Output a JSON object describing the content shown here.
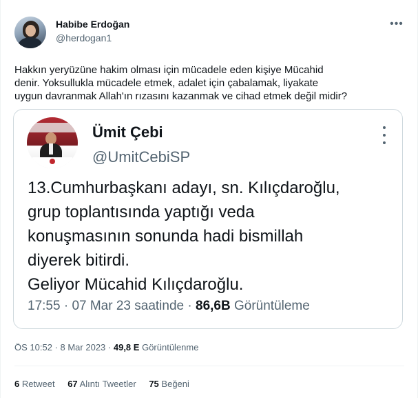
{
  "tweet": {
    "author_name": "Habibe Erdoğan",
    "author_handle": "@herdogan1",
    "more_icon": "ellipsis-icon",
    "text_lines": [
      "Hakkın yeryüzüne hakim olması için mücadele eden kişiye Mücahid",
      "denir. Yoksullukla mücadele etmek, adalet için çabalamak, liyakate",
      "uygun davranmak Allah'ın rızasını kazanmak ve cihad etmek değil midir?"
    ],
    "time": "ÖS 10:52",
    "date": "8 Mar 2023",
    "views_count": "49,8 E",
    "views_label": "Görüntülenme",
    "retweets_count": "6",
    "retweets_label": "Retweet",
    "quotes_count": "67",
    "quotes_label": "Alıntı Tweetler",
    "likes_count": "75",
    "likes_label": "Beğeni"
  },
  "quoted": {
    "author_name": "Ümit Çebi",
    "author_handle": "@UmitCebiSP",
    "more_icon": "vertical-ellipsis-icon",
    "text_lines": [
      "13.Cumhurbaşkanı adayı, sn. Kılıçdaroğlu,",
      "grup toplantısında  yaptığı veda",
      "konuşmasının sonunda hadi bismillah",
      "diyerek bitirdi.",
      "Geliyor Mücahid Kılıçdaroğlu."
    ],
    "time": "17:55",
    "date": "07 Mar 23 saatinde",
    "views_count": "86,6B",
    "views_label": "Görüntüleme"
  },
  "colors": {
    "text_primary": "#0f1419",
    "text_secondary": "#536471",
    "border": "#cfd9de",
    "divider": "#eff3f4"
  }
}
